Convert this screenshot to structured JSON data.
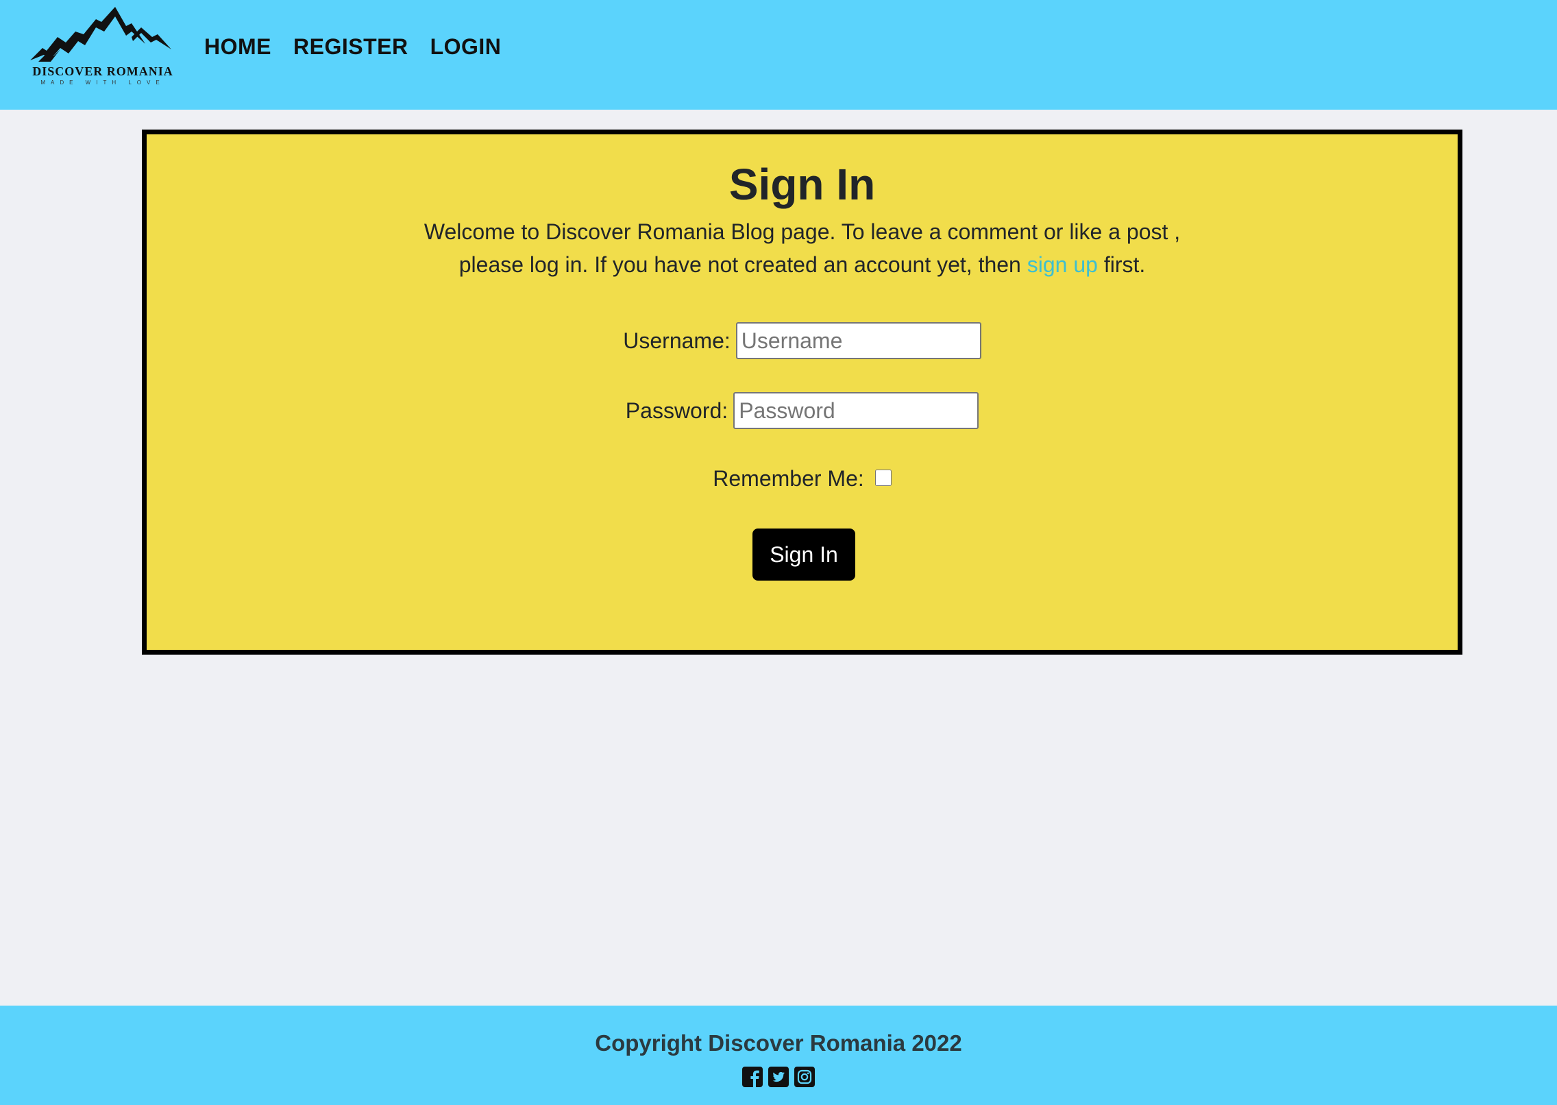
{
  "brand": {
    "name": "DISCOVER ROMANIA",
    "tagline": "MADE WITH LOVE"
  },
  "nav": {
    "items": [
      {
        "label": "HOME"
      },
      {
        "label": "REGISTER"
      },
      {
        "label": "LOGIN"
      }
    ]
  },
  "signin": {
    "title": "Sign In",
    "intro_before": "Welcome to Discover Romania Blog page. To leave a comment or like a post , please log in. If you have not created an account yet, then ",
    "signup_link": "sign up",
    "intro_after": " first.",
    "username_label": "Username:",
    "username_placeholder": "Username",
    "username_value": "",
    "password_label": "Password:",
    "password_placeholder": "Password",
    "password_value": "",
    "remember_label": "Remember Me:",
    "remember_checked": false,
    "button_label": "Sign In"
  },
  "footer": {
    "copyright": "Copyright Discover Romania 2022",
    "social_icons": [
      "facebook-icon",
      "twitter-icon",
      "instagram-icon"
    ]
  },
  "colors": {
    "header_bg": "#5bd3fc",
    "page_bg": "#eff0f4",
    "card_bg": "#f1dd4b",
    "card_border": "#000000",
    "link": "#3fbfcf",
    "button_bg": "#000000"
  }
}
